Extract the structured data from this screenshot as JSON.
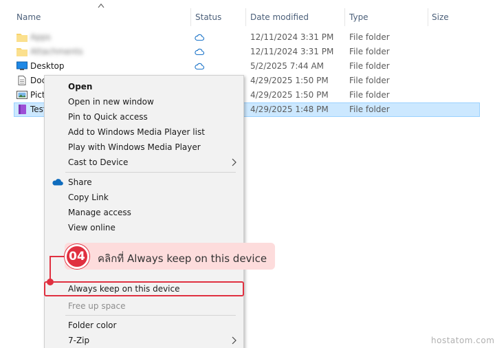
{
  "columns": {
    "name": "Name",
    "status": "Status",
    "date_modified": "Date modified",
    "type": "Type",
    "size": "Size"
  },
  "rows": [
    {
      "name": "Apps",
      "blurred": true,
      "icon": "folder-icon",
      "status": "cloud-icon",
      "date": "12/11/2024 3:31 PM",
      "type": "File folder"
    },
    {
      "name": "Attachments",
      "blurred": true,
      "icon": "folder-icon",
      "status": "cloud-icon",
      "date": "12/11/2024 3:31 PM",
      "type": "File folder"
    },
    {
      "name": "Desktop",
      "blurred": false,
      "icon": "desktop-icon",
      "status": "cloud-icon",
      "date": "5/2/2025 7:44 AM",
      "type": "File folder"
    },
    {
      "name": "Doc",
      "blurred": false,
      "icon": "documents-icon",
      "status": "",
      "date": "4/29/2025 1:50 PM",
      "type": "File folder"
    },
    {
      "name": "Pict",
      "blurred": false,
      "icon": "pictures-icon",
      "status": "",
      "date": "4/29/2025 1:50 PM",
      "type": "File folder"
    },
    {
      "name": "Test",
      "blurred": false,
      "icon": "purple-folder-icon",
      "status": "",
      "date": "4/29/2025 1:48 PM",
      "type": "File folder",
      "selected": true
    }
  ],
  "menu": {
    "open": "Open",
    "open_new_window": "Open in new window",
    "pin_quick_access": "Pin to Quick access",
    "add_media_player_list": "Add to Windows Media Player list",
    "play_media_player": "Play with Windows Media Player",
    "cast_to_device": "Cast to Device",
    "share": "Share",
    "copy_link": "Copy Link",
    "manage_access": "Manage access",
    "view_online": "View online",
    "always_keep": "Always keep on this device",
    "free_up_space": "Free up space",
    "folder_color": "Folder color",
    "seven_zip": "7-Zip"
  },
  "callout": {
    "step": "04",
    "text": "คลิกที่ Always keep on this device"
  },
  "watermark": "hostatom.com",
  "colors": {
    "accent": "#e03040",
    "selection": "#cce8ff",
    "onedrive": "#0f6cbd",
    "callout_bg": "#fddcdc"
  }
}
